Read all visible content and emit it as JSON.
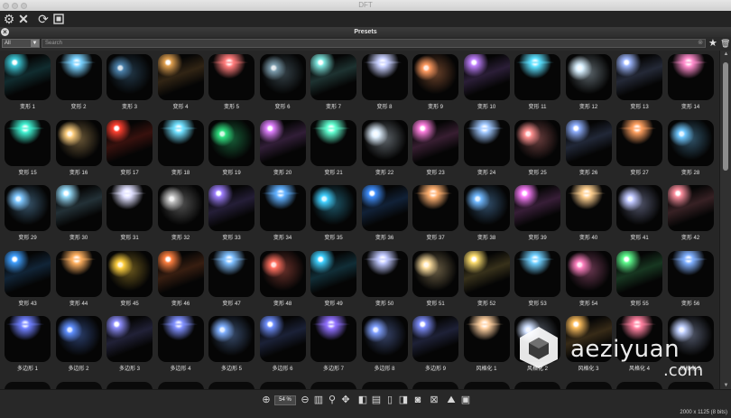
{
  "window": {
    "title": "DFT"
  },
  "toolbar": {
    "icons": [
      "gear-icon",
      "close-x-icon",
      "fit-frame-icon",
      "refresh-icon",
      "crop-frame-icon"
    ]
  },
  "panel": {
    "title": "Presets",
    "close_label": "×"
  },
  "filter": {
    "category_value": "All",
    "search_placeholder": "Search"
  },
  "presets": [
    [
      "变形 1",
      "变形 2",
      "变形 3",
      "变形 4",
      "变形 5",
      "变形 6",
      "变形 7",
      "变形 8",
      "变形 9",
      "变形 10",
      "变形 11",
      "变形 12",
      "变形 13",
      "变形 14"
    ],
    [
      "变形 15",
      "变形 16",
      "变形 17",
      "变形 18",
      "变形 19",
      "变形 20",
      "变形 21",
      "变形 22",
      "变形 23",
      "变形 24",
      "变形 25",
      "变形 26",
      "变形 27",
      "变形 28"
    ],
    [
      "变形 29",
      "变形 30",
      "变形 31",
      "变形 32",
      "变形 33",
      "变形 34",
      "变形 35",
      "变形 36",
      "变形 37",
      "变形 38",
      "变形 39",
      "变形 40",
      "变形 41",
      "变形 42"
    ],
    [
      "变形 43",
      "变形 44",
      "变形 45",
      "变形 46",
      "变形 47",
      "变形 48",
      "变形 49",
      "变形 50",
      "变形 51",
      "变形 52",
      "变形 53",
      "变形 54",
      "变形 55",
      "变形 56"
    ],
    [
      "多边形 1",
      "多边形 2",
      "多边形 3",
      "多边形 4",
      "多边形 5",
      "多边形 6",
      "多边形 7",
      "多边形 8",
      "多边形 9",
      "风格化 1",
      "风格化 2",
      "风格化 3",
      "风格化 4",
      "风格化 5"
    ]
  ],
  "thumb_colors": [
    [
      "#3ec9d8",
      "#7ad2ff",
      "#4a7fa8",
      "#e0a050",
      "#ff7a7a",
      "#7a9aaa",
      "#7fe8e0",
      "#c8d0ff",
      "#ff9a60",
      "#c080ff",
      "#5ae0ff",
      "#d8f0ff",
      "#9fb8ff",
      "#ff8acb"
    ],
    [
      "#40f0d0",
      "#ffd080",
      "#ff4030",
      "#70e0ff",
      "#30e080",
      "#e080ff",
      "#60ffd0",
      "#e0f0ff",
      "#ff80e0",
      "#a0c8ff",
      "#ff9090",
      "#90b0ff",
      "#ffa060",
      "#70c8ff"
    ],
    [
      "#80c8ff",
      "#9ae0ff",
      "#e0e0ff",
      "#c0c0c0",
      "#a080ff",
      "#60b0ff",
      "#40d0ff",
      "#4090ff",
      "#ffb070",
      "#70b8ff",
      "#ff80ff",
      "#ffd090",
      "#c0c8ff",
      "#ff90a0"
    ],
    [
      "#40a0ff",
      "#ffb060",
      "#ffd040",
      "#ff8040",
      "#80c0ff",
      "#ff7060",
      "#40d0ff",
      "#c0c8ff",
      "#ffe0a0",
      "#ffe070",
      "#70d0ff",
      "#ff80c0",
      "#60ff90",
      "#80b0ff"
    ],
    [
      "#7080ff",
      "#6090ff",
      "#9090ff",
      "#8090ff",
      "#80b0ff",
      "#7090ff",
      "#9070ff",
      "#80a0ff",
      "#8090ff",
      "#ffd0a0",
      "#d0e0ff",
      "#ffc060",
      "#ff80a0",
      "#c0d0ff"
    ]
  ],
  "zoom": {
    "value": "54 %"
  },
  "status": {
    "image_size": "2000 x 1125 (8 bits)"
  },
  "watermark": {
    "text": "aeziyuan",
    "domain": ".com"
  }
}
